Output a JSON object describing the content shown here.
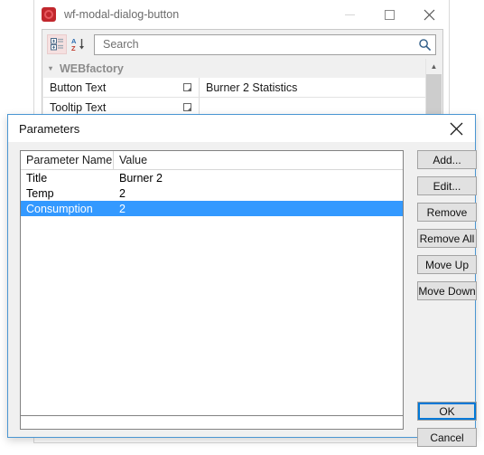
{
  "host_window": {
    "title": "wf-modal-dialog-button",
    "icon": "app-icon",
    "controls": {
      "minimize": "minimize-icon",
      "maximize": "maximize-icon",
      "close": "close-icon"
    },
    "toolbar": {
      "categorized_icon": "categorized-view-icon",
      "sort_icon": "alphabetical-sort-icon",
      "search_placeholder": "Search",
      "search_value": "",
      "search_icon": "search-icon"
    },
    "property_grid": {
      "category": "WEBfactory",
      "collapse_icon": "triangle-collapse-icon",
      "rows": [
        {
          "name": "Button Text",
          "value": "Burner 2 Statistics",
          "editor_icon": "ellipsis-editor-icon"
        },
        {
          "name": "Tooltip Text",
          "value": "",
          "editor_icon": "ellipsis-editor-icon"
        }
      ],
      "scroll_up_icon": "chevron-up-icon"
    }
  },
  "dialog": {
    "title": "Parameters",
    "close_icon": "close-icon",
    "table": {
      "columns": [
        "Parameter Name",
        "Value"
      ],
      "rows": [
        {
          "name": "Title",
          "value": "Burner 2",
          "selected": false
        },
        {
          "name": "Temp",
          "value": "2",
          "selected": false
        },
        {
          "name": "Consumption",
          "value": "2",
          "selected": true
        }
      ]
    },
    "side_buttons": [
      {
        "label": "Add...",
        "name": "add-button"
      },
      {
        "label": "Edit...",
        "name": "edit-button"
      },
      {
        "label": "Remove",
        "name": "remove-button"
      },
      {
        "label": "Remove All",
        "name": "remove-all-button"
      },
      {
        "label": "Move Up",
        "name": "move-up-button"
      },
      {
        "label": "Move Down",
        "name": "move-down-button"
      }
    ],
    "ok_label": "OK",
    "cancel_label": "Cancel"
  },
  "colors": {
    "selection_blue": "#3399ff",
    "dialog_border_blue": "#4a96d2",
    "focus_blue": "#0078d7",
    "accent_red": "#c1272d",
    "link_blue": "#1414d2"
  }
}
